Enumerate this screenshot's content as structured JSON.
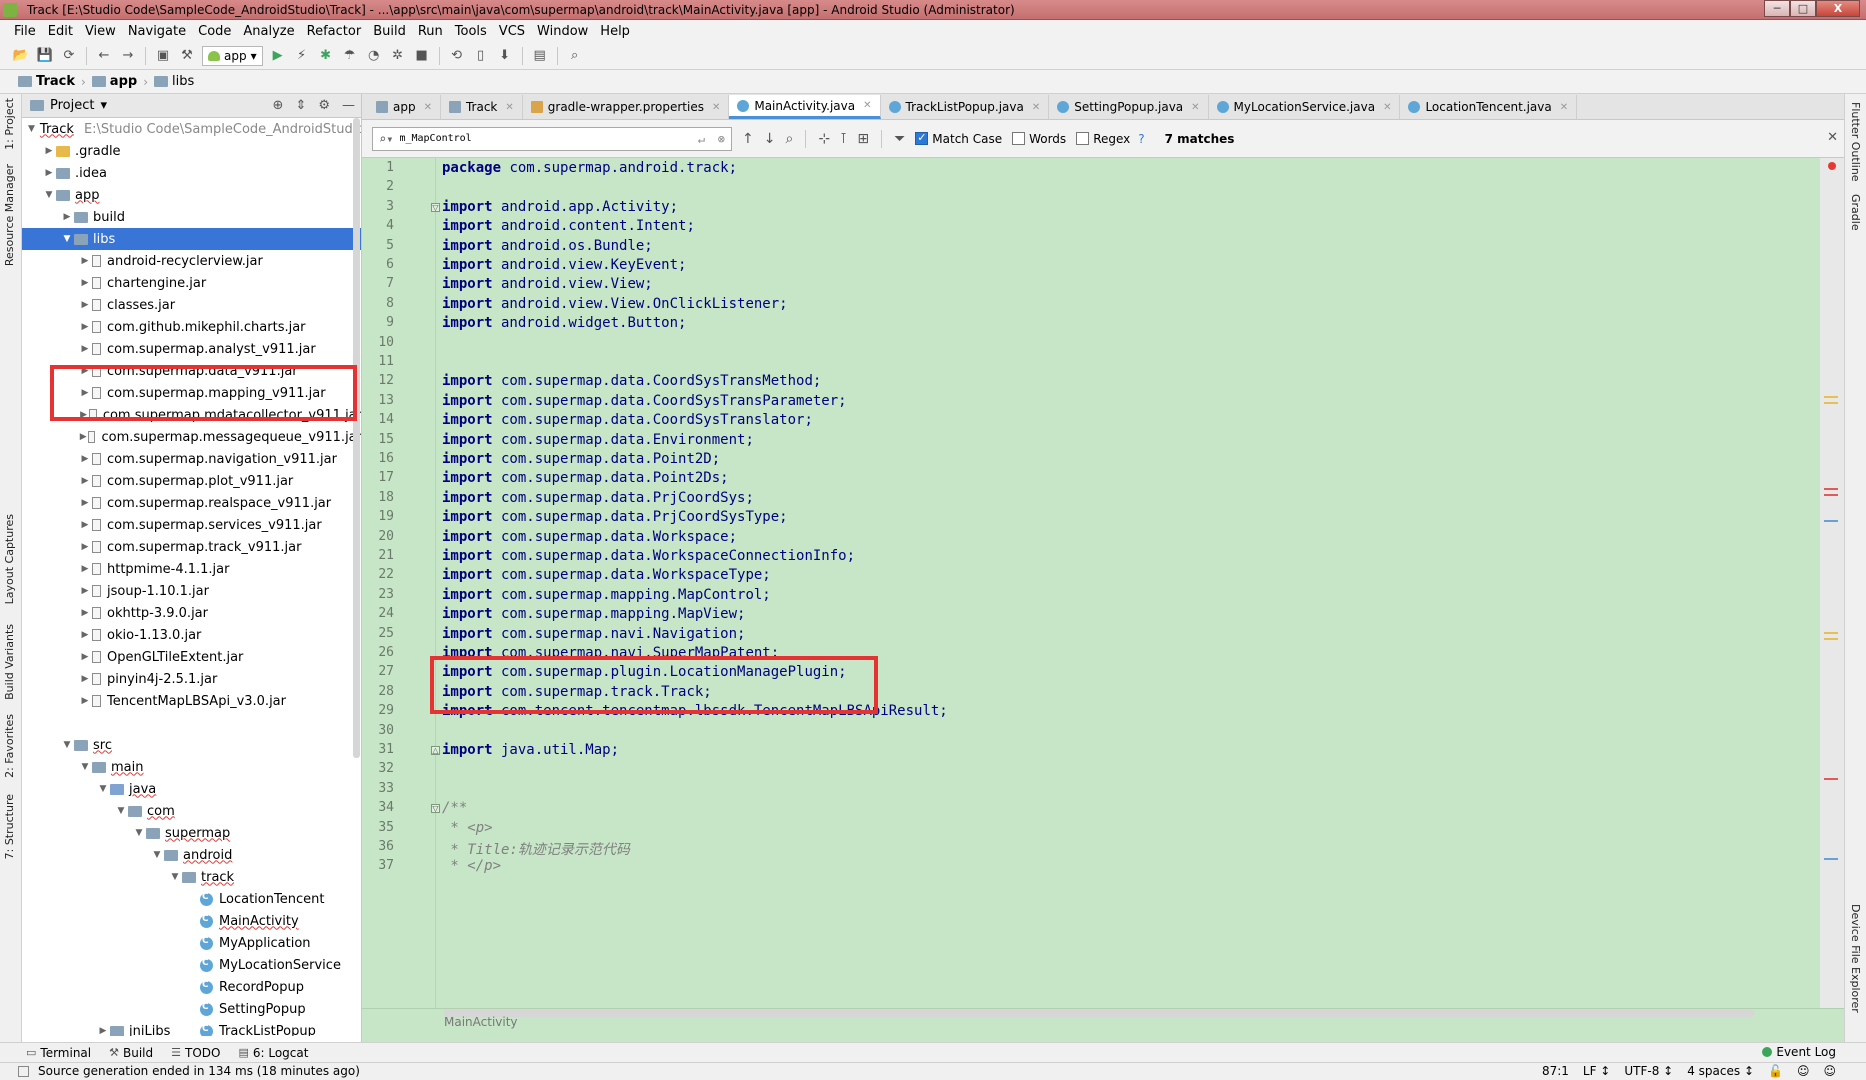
{
  "window": {
    "title": "Track [E:\\Studio Code\\SampleCode_AndroidStudio\\Track] - ...\\app\\src\\main\\java\\com\\supermap\\android\\track\\MainActivity.java [app] - Android Studio (Administrator)",
    "minimize": "─",
    "maximize": "□",
    "close": "X"
  },
  "menu": {
    "items": [
      "File",
      "Edit",
      "View",
      "Navigate",
      "Code",
      "Analyze",
      "Refactor",
      "Build",
      "Run",
      "Tools",
      "VCS",
      "Window",
      "Help"
    ]
  },
  "toolbar": {
    "run_config": "app"
  },
  "breadcrumb": [
    "Track",
    "app",
    "libs"
  ],
  "left_tool_tabs": [
    "1: Project",
    "Resource Manager",
    "Layout Captures",
    "Build Variants",
    "2: Favorites",
    "7: Structure"
  ],
  "right_tool_tabs": [
    "Flutter Outline",
    "Gradle",
    "Device File Explorer"
  ],
  "project": {
    "header": "Project",
    "root_name": "Track",
    "root_path": "E:\\Studio Code\\SampleCode_AndroidStudio\\Track",
    "nodes": {
      "gradle": ".gradle",
      "idea": ".idea",
      "app": "app",
      "build": "build",
      "libs": "libs",
      "src": "src",
      "main": "main",
      "java": "java",
      "com": "com",
      "supermap": "supermap",
      "android": "android",
      "track": "track",
      "jnilibs": "jniLibs"
    },
    "jars": [
      "android-recyclerview.jar",
      "chartengine.jar",
      "classes.jar",
      "com.github.mikephil.charts.jar",
      "com.supermap.analyst_v911.jar",
      "com.supermap.data_v911.jar",
      "com.supermap.mapping_v911.jar",
      "com.supermap.mdatacollector_v911.jar",
      "com.supermap.messagequeue_v911.jar",
      "com.supermap.navigation_v911.jar",
      "com.supermap.plot_v911.jar",
      "com.supermap.realspace_v911.jar",
      "com.supermap.services_v911.jar",
      "com.supermap.track_v911.jar",
      "httpmime-4.1.1.jar",
      "jsoup-1.10.1.jar",
      "okhttp-3.9.0.jar",
      "okio-1.13.0.jar",
      "OpenGLTileExtent.jar",
      "pinyin4j-2.5.1.jar",
      "TencentMapLBSApi_v3.0.jar"
    ],
    "classes": [
      "LocationTencent",
      "MainActivity",
      "MyApplication",
      "MyLocationService",
      "RecordPopup",
      "SettingPopup",
      "TrackListPopup"
    ]
  },
  "tabs": [
    {
      "label": "app",
      "icon": "folder-icon"
    },
    {
      "label": "Track",
      "icon": "folder-icon"
    },
    {
      "label": "gradle-wrapper.properties",
      "icon": "properties-file-icon"
    },
    {
      "label": "MainActivity.java",
      "icon": "class-icon",
      "active": true
    },
    {
      "label": "TrackListPopup.java",
      "icon": "class-icon"
    },
    {
      "label": "SettingPopup.java",
      "icon": "class-icon"
    },
    {
      "label": "MyLocationService.java",
      "icon": "class-icon"
    },
    {
      "label": "LocationTencent.java",
      "icon": "class-icon"
    }
  ],
  "find": {
    "query": "m_MapControl",
    "match_case": "Match Case",
    "words": "Words",
    "regex": "Regex",
    "regex_help": "?",
    "matches": "7 matches"
  },
  "code_lines": [
    {
      "n": "1",
      "kw": "package",
      "rest": " com.supermap.android.track;"
    },
    {
      "n": "2",
      "kw": "",
      "rest": ""
    },
    {
      "n": "3",
      "kw": "import",
      "rest": " android.app.Activity;"
    },
    {
      "n": "4",
      "kw": "import",
      "rest": " android.content.Intent;"
    },
    {
      "n": "5",
      "kw": "import",
      "rest": " android.os.Bundle;"
    },
    {
      "n": "6",
      "kw": "import",
      "rest": " android.view.KeyEvent;"
    },
    {
      "n": "7",
      "kw": "import",
      "rest": " android.view.View;"
    },
    {
      "n": "8",
      "kw": "import",
      "rest": " android.view.View.OnClickListener;"
    },
    {
      "n": "9",
      "kw": "import",
      "rest": " android.widget.Button;"
    },
    {
      "n": "10",
      "kw": "",
      "rest": ""
    },
    {
      "n": "11",
      "kw": "",
      "rest": ""
    },
    {
      "n": "12",
      "kw": "import",
      "rest": " com.supermap.data.CoordSysTransMethod;"
    },
    {
      "n": "13",
      "kw": "import",
      "rest": " com.supermap.data.CoordSysTransParameter;"
    },
    {
      "n": "14",
      "kw": "import",
      "rest": " com.supermap.data.CoordSysTranslator;"
    },
    {
      "n": "15",
      "kw": "import",
      "rest": " com.supermap.data.Environment;"
    },
    {
      "n": "16",
      "kw": "import",
      "rest": " com.supermap.data.Point2D;"
    },
    {
      "n": "17",
      "kw": "import",
      "rest": " com.supermap.data.Point2Ds;"
    },
    {
      "n": "18",
      "kw": "import",
      "rest": " com.supermap.data.PrjCoordSys;"
    },
    {
      "n": "19",
      "kw": "import",
      "rest": " com.supermap.data.PrjCoordSysType;"
    },
    {
      "n": "20",
      "kw": "import",
      "rest": " com.supermap.data.Workspace;"
    },
    {
      "n": "21",
      "kw": "import",
      "rest": " com.supermap.data.WorkspaceConnectionInfo;"
    },
    {
      "n": "22",
      "kw": "import",
      "rest": " com.supermap.data.WorkspaceType;"
    },
    {
      "n": "23",
      "kw": "import",
      "rest": " com.supermap.mapping.MapControl;"
    },
    {
      "n": "24",
      "kw": "import",
      "rest": " com.supermap.mapping.MapView;"
    },
    {
      "n": "25",
      "kw": "import",
      "rest": " com.supermap.navi.Navigation;"
    },
    {
      "n": "26",
      "kw": "import",
      "rest": " com.supermap.navi.SuperMapPatent;"
    },
    {
      "n": "27",
      "kw": "import",
      "rest": " com.supermap.plugin.LocationManagePlugin;"
    },
    {
      "n": "28",
      "kw": "import",
      "rest": " com.supermap.track.Track;"
    },
    {
      "n": "29",
      "kw": "import",
      "rest": " com.tencent.tencentmap.lbssdk.TencentMapLBSApiResult;"
    },
    {
      "n": "30",
      "kw": "",
      "rest": ""
    },
    {
      "n": "31",
      "kw": "import",
      "rest": " java.util.Map;"
    },
    {
      "n": "32",
      "kw": "",
      "rest": ""
    },
    {
      "n": "33",
      "kw": "",
      "rest": ""
    },
    {
      "n": "34",
      "kw": "",
      "rest": "/**",
      "comment": true
    },
    {
      "n": "35",
      "kw": "",
      "rest": " * <p>",
      "comment": true
    },
    {
      "n": "36",
      "kw": "",
      "rest": " * Title:轨迹记录示范代码",
      "comment": true
    },
    {
      "n": "37",
      "kw": "",
      "rest": " * </p>",
      "comment": true
    }
  ],
  "editor_breadcrumb": "MainActivity",
  "bottom_tools": [
    {
      "label": "Terminal",
      "icon": "terminal-icon"
    },
    {
      "label": "Build",
      "icon": "hammer-icon"
    },
    {
      "label": "TODO",
      "icon": "list-icon"
    },
    {
      "label": "6: Logcat",
      "icon": "logcat-icon"
    }
  ],
  "event_log": "Event Log",
  "status": {
    "message": "Source generation ended in 134 ms (18 minutes ago)",
    "position": "87:1",
    "line_sep": "LF ↕",
    "encoding": "UTF-8 ↕",
    "indent": "4 spaces ↕"
  },
  "colors": {
    "editor_bg": "#c7e6c7",
    "selection": "#3875d7",
    "annotation_red": "#e53232",
    "keyword": "#000080"
  }
}
